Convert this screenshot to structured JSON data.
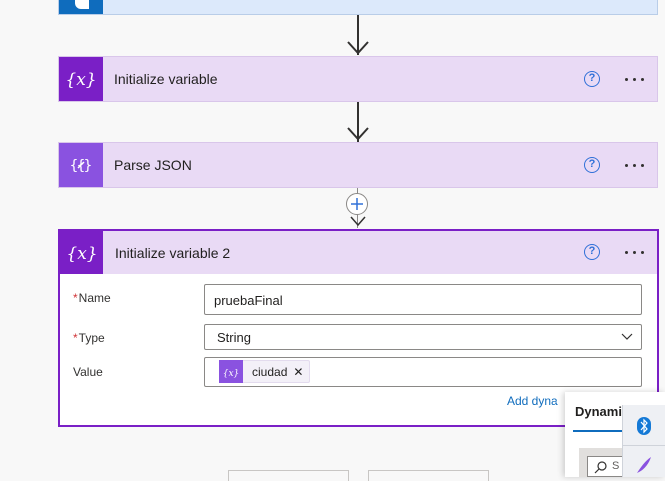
{
  "flow": {
    "cards": [
      {
        "title": "Initialize variable",
        "icon": "variable-icon"
      },
      {
        "title": "Parse JSON",
        "icon": "parse-json-icon"
      }
    ],
    "expanded": {
      "title": "Initialize variable 2",
      "icon": "variable-icon",
      "fields": {
        "name_label": "Name",
        "name_value": "pruebaFinal",
        "type_label": "Type",
        "type_value": "String",
        "value_label": "Value",
        "value_token": "ciudad"
      },
      "add_dynamic_label": "Add dyna"
    }
  },
  "dynamic_panel": {
    "tab_label": "Dynami"
  },
  "colors": {
    "variable_purple": "#7a1fc6",
    "parse_purple": "#8a52e0",
    "card_bg": "#e9daf5",
    "link_blue": "#0f6cbd",
    "trigger_blue": "#0f6cbd"
  },
  "icons": [
    "help-icon",
    "more-options-icon",
    "add-step-icon",
    "chevron-down-icon",
    "remove-token-icon",
    "search-icon",
    "bluetooth-icon",
    "quill-icon"
  ]
}
